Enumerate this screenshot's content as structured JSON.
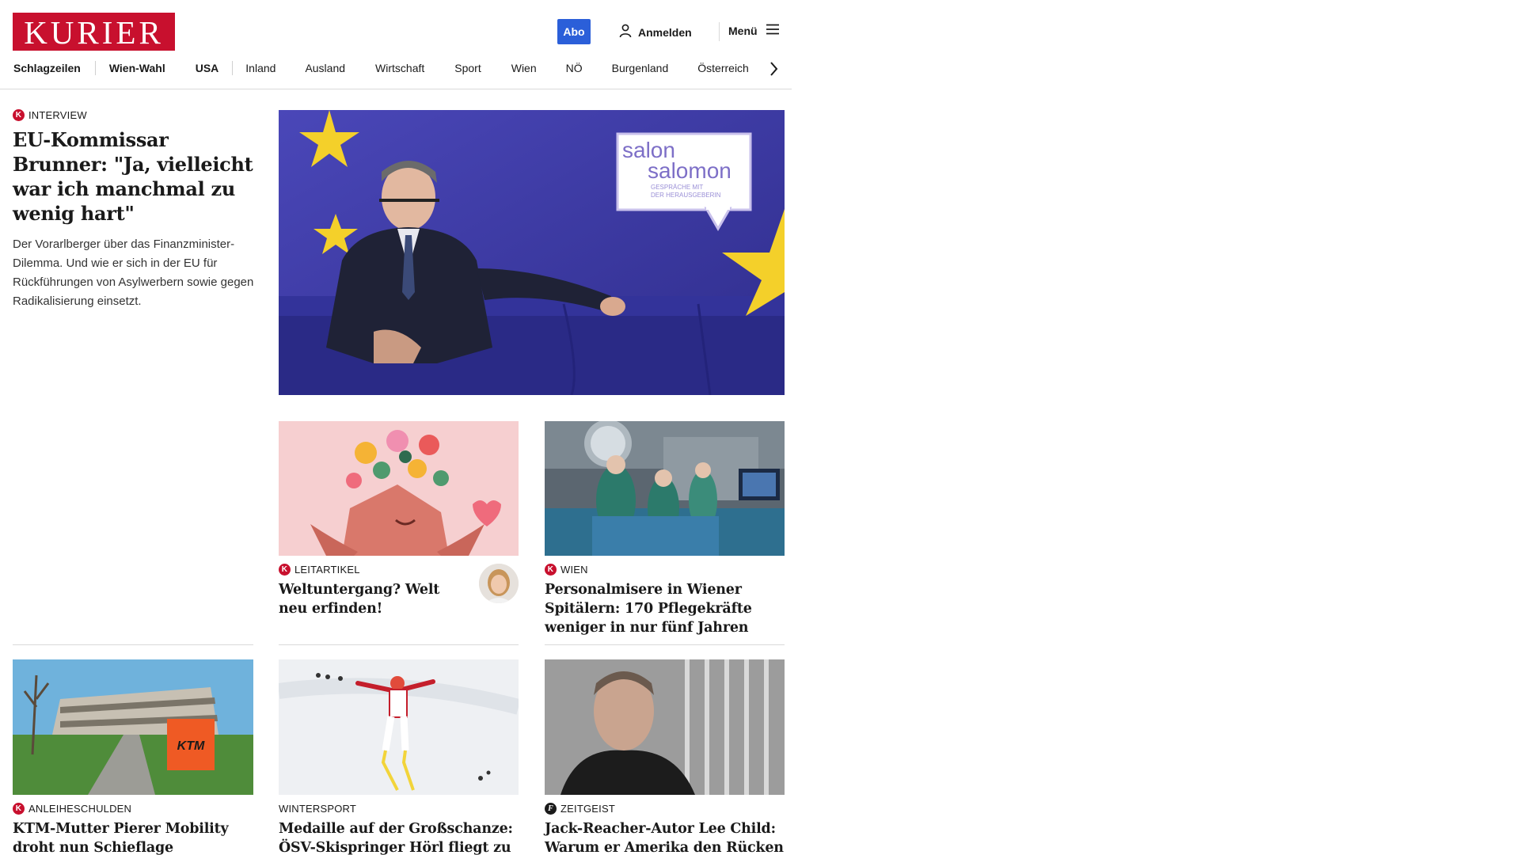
{
  "header": {
    "logo_text": "KURIER",
    "abo_label": "Abo",
    "login_label": "Anmelden",
    "menu_label": "Menü",
    "brand_color": "#c8102e",
    "accent_color": "#2b5fd9"
  },
  "nav": {
    "items": [
      "Schlagzeilen",
      "Wien-Wahl",
      "USA",
      "Inland",
      "Ausland",
      "Wirtschaft",
      "Sport",
      "Wien",
      "NÖ",
      "Burgenland",
      "Österreich"
    ]
  },
  "lead": {
    "kicker": "INTERVIEW",
    "headline": "EU-Kommissar Brunner: \"Ja, vielleicht war ich manchmal zu wenig hart\"",
    "teaser": "Der Vorarlberger über das Finanzminister-Dilemma. Und wie er sich in der EU für Rückführungen von Asylwerbern sowie gegen Radikalisierung einsetzt.",
    "image_overlay": {
      "line1": "salon",
      "line2": "salomon",
      "sub1": "GESPRÄCHE MIT",
      "sub2": "DER HERAUSGEBERIN"
    }
  },
  "articles": [
    {
      "kicker": "LEITARTIKEL",
      "headline": "Weltuntergang? Welt neu erfinden!",
      "badge": "k"
    },
    {
      "kicker": "WIEN",
      "headline": "Personalmisere in Wiener Spitälern: 170 Pflegekräfte weniger in nur fünf Jahren",
      "badge": "k"
    },
    {
      "kicker": "ANLEIHESCHULDEN",
      "headline": "KTM-Mutter Pierer Mobility droht nun Schieflage",
      "badge": "k",
      "sign_text": "KTM"
    },
    {
      "kicker": "WINTERSPORT",
      "headline": "Medaille auf der Großschanze: ÖSV-Skispringer Hörl fliegt zu Silber",
      "badge": ""
    },
    {
      "kicker": "ZEITGEIST",
      "headline": "Jack-Reacher-Autor Lee Child: Warum er Amerika den Rücken kehrt",
      "badge": "f"
    }
  ]
}
